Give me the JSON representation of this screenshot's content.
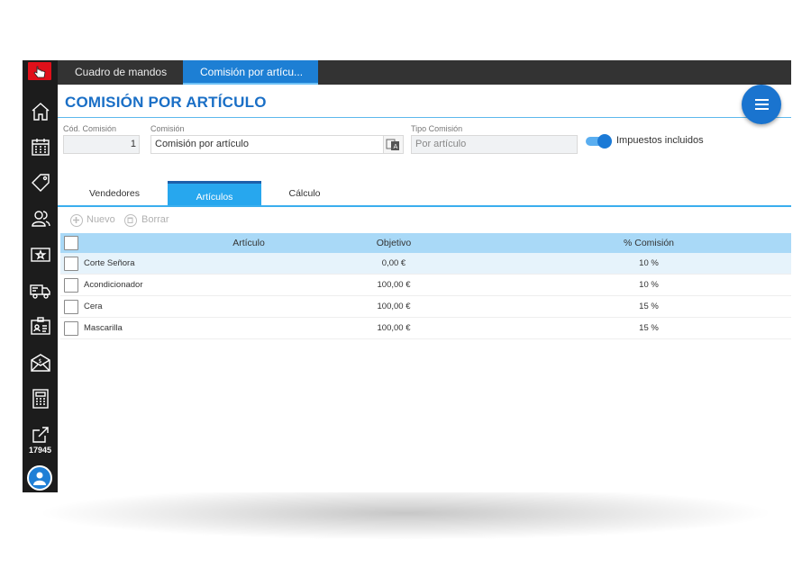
{
  "tabs_top": [
    {
      "label": "Cuadro de mandos"
    },
    {
      "label": "Comisión por artícu..."
    }
  ],
  "sidebar": {
    "items": [
      {
        "icon": "home-icon"
      },
      {
        "icon": "calendar-icon"
      },
      {
        "icon": "tag-icon"
      },
      {
        "icon": "users-icon"
      },
      {
        "icon": "star-card-icon"
      },
      {
        "icon": "truck-icon"
      },
      {
        "icon": "id-card-icon"
      },
      {
        "icon": "mail-money-icon"
      },
      {
        "icon": "calculator-icon"
      },
      {
        "icon": "share-icon"
      }
    ],
    "count": "17945"
  },
  "page": {
    "title": "COMISIÓN POR ARTÍCULO"
  },
  "form": {
    "code_label": "Cód. Comisión",
    "code_value": "1",
    "name_label": "Comisión",
    "name_value": "Comisión por artículo",
    "type_label": "Tipo Comisión",
    "type_value": "Por artículo",
    "tax_label": "Impuestos incluidos"
  },
  "subtabs": [
    {
      "label": "Vendedores"
    },
    {
      "label": "Artículos"
    },
    {
      "label": "Cálculo"
    }
  ],
  "toolbar": {
    "new_label": "Nuevo",
    "delete_label": "Borrar"
  },
  "table": {
    "headers": [
      "Artículo",
      "Objetivo",
      "% Comisión"
    ],
    "rows": [
      {
        "articulo": "Corte Señora",
        "objetivo": "0,00 €",
        "comision": "10 %"
      },
      {
        "articulo": "Acondicionador",
        "objetivo": "100,00 €",
        "comision": "10 %"
      },
      {
        "articulo": "Cera",
        "objetivo": "100,00 €",
        "comision": "15 %"
      },
      {
        "articulo": "Mascarilla",
        "objetivo": "100,00 €",
        "comision": "15 %"
      }
    ]
  },
  "colors": {
    "accent": "#1d7fd4",
    "sidebar": "#1c1c1c",
    "topbar": "#333333",
    "header_row": "#a9d9f7",
    "brand_red": "#e0101a"
  }
}
